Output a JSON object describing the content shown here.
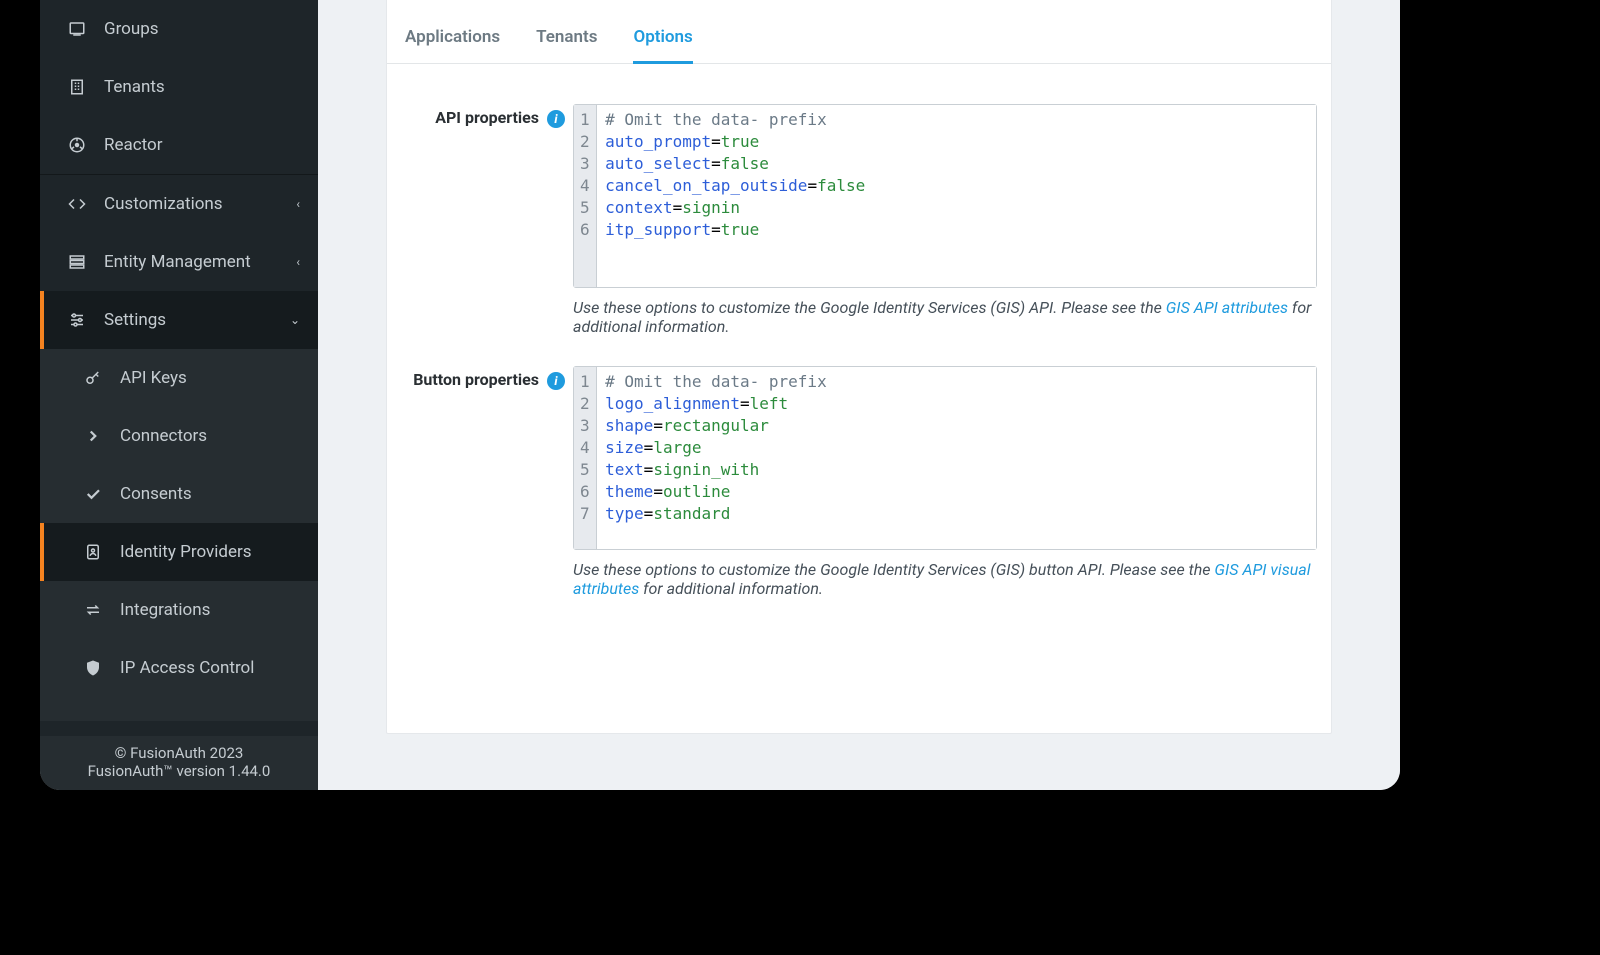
{
  "sidebar": {
    "groups": "Groups",
    "tenants": "Tenants",
    "reactor": "Reactor",
    "customizations": "Customizations",
    "entity_management": "Entity Management",
    "settings": "Settings",
    "api_keys": "API Keys",
    "connectors": "Connectors",
    "consents": "Consents",
    "identity_providers": "Identity Providers",
    "integrations": "Integrations",
    "ip_access": "IP Access Control"
  },
  "footer": {
    "line1": "© FusionAuth 2023",
    "line2": "FusionAuth™ version 1.44.0"
  },
  "tabs": {
    "applications": "Applications",
    "tenants": "Tenants",
    "options": "Options"
  },
  "labels": {
    "api_properties": "API properties",
    "button_properties": "Button properties"
  },
  "code": {
    "api": {
      "l1": {
        "comment": "# Omit the data- prefix"
      },
      "l2": {
        "key": "auto_prompt",
        "eq": "=",
        "val": "true"
      },
      "l3": {
        "key": "auto_select",
        "eq": "=",
        "val": "false"
      },
      "l4": {
        "key": "cancel_on_tap_outside",
        "eq": "=",
        "val": "false"
      },
      "l5": {
        "key": "context",
        "eq": "=",
        "val": "signin"
      },
      "l6": {
        "key": "itp_support",
        "eq": "=",
        "val": "true"
      }
    },
    "button": {
      "l1": {
        "comment": "# Omit the data- prefix"
      },
      "l2": {
        "key": "logo_alignment",
        "eq": "=",
        "val": "left"
      },
      "l3": {
        "key": "shape",
        "eq": "=",
        "val": "rectangular"
      },
      "l4": {
        "key": "size",
        "eq": "=",
        "val": "large"
      },
      "l5": {
        "key": "text",
        "eq": "=",
        "val": "signin_with"
      },
      "l6": {
        "key": "theme",
        "eq": "=",
        "val": "outline"
      },
      "l7": {
        "key": "type",
        "eq": "=",
        "val": "standard"
      }
    }
  },
  "help": {
    "api_pre": "Use these options to customize the Google Identity Services (GIS) API. Please see the ",
    "api_link": "GIS API attributes",
    "api_post": " for additional information.",
    "btn_pre": "Use these options to customize the Google Identity Services (GIS) button API. Please see the ",
    "btn_link": "GIS API visual attributes",
    "btn_post": " for additional information."
  },
  "nums": {
    "n1": "1",
    "n2": "2",
    "n3": "3",
    "n4": "4",
    "n5": "5",
    "n6": "6",
    "n7": "7"
  }
}
